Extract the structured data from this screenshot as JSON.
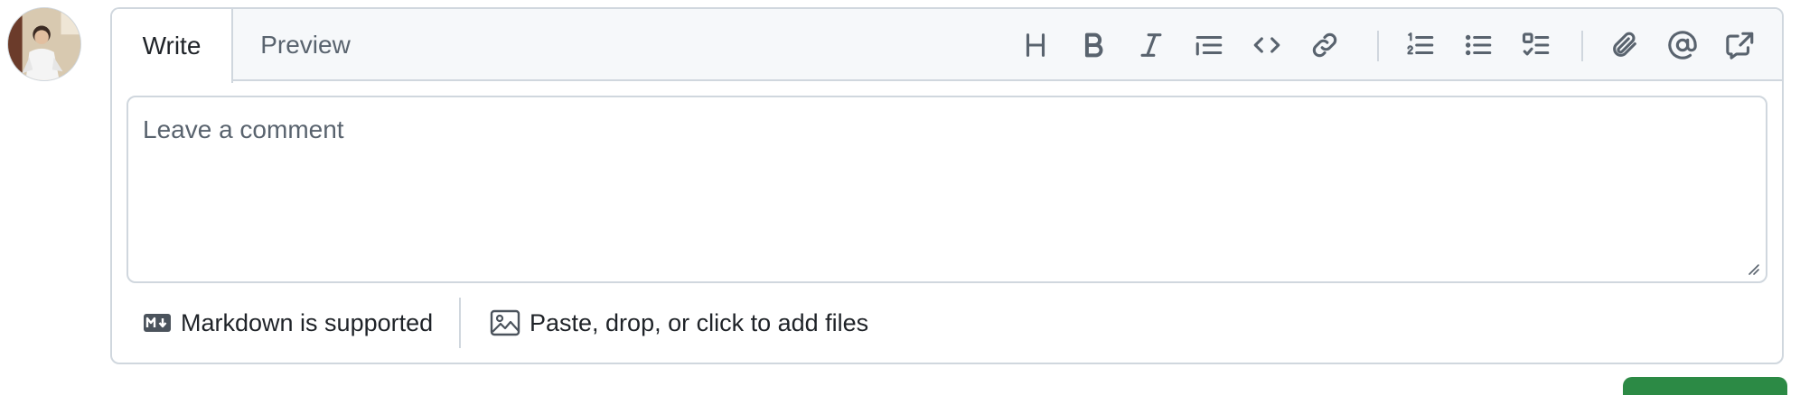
{
  "user": {
    "avatar_icon": "user-avatar"
  },
  "editor": {
    "tabs": [
      {
        "label": "Write",
        "selected": true
      },
      {
        "label": "Preview",
        "selected": false
      }
    ],
    "toolbar": [
      {
        "name": "heading",
        "icon": "heading-icon"
      },
      {
        "name": "bold",
        "icon": "bold-icon"
      },
      {
        "name": "italic",
        "icon": "italic-icon"
      },
      {
        "name": "quote",
        "icon": "quote-icon"
      },
      {
        "name": "code",
        "icon": "code-icon"
      },
      {
        "name": "link",
        "icon": "link-icon"
      },
      {
        "name": "numbered-list",
        "icon": "ordered-list-icon"
      },
      {
        "name": "bulleted-list",
        "icon": "unordered-list-icon"
      },
      {
        "name": "task-list",
        "icon": "task-list-icon"
      },
      {
        "name": "attach",
        "icon": "paperclip-icon"
      },
      {
        "name": "mention",
        "icon": "at-sign-icon"
      },
      {
        "name": "reference",
        "icon": "cross-reference-icon"
      }
    ],
    "textarea": {
      "value": "",
      "placeholder": "Leave a comment"
    },
    "footer": {
      "markdown_label": "Markdown is supported",
      "files_label": "Paste, drop, or click to add files"
    }
  },
  "colors": {
    "border": "#d0d7de",
    "header_bg": "#f6f8fa",
    "muted_text": "#59636e",
    "text": "#1f2328",
    "primary_button": "#2c8a45"
  }
}
